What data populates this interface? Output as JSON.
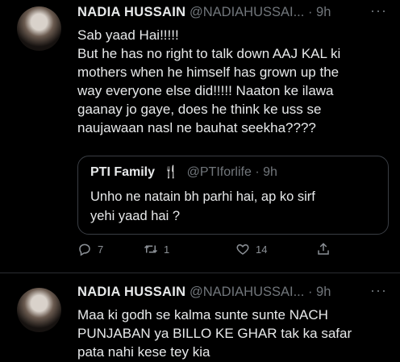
{
  "tweets": [
    {
      "name": "NADIA HUSSAIN",
      "handle": "@NADIAHUSSAI...",
      "separator": "·",
      "time": "9h",
      "more": "···",
      "lines": [
        "Sab yaad Hai!!!!!",
        "But he has no right to talk down AAJ KAL ki",
        "mothers when he himself has grown up the",
        "way everyone else did!!!!! Naaton ke ilawa",
        "gaanay jo gaye, does he think ke uss se",
        "naujawaan nasl ne bauhat seekha????"
      ],
      "quote": {
        "name": "PTI Family",
        "badge": "🍴",
        "handle": "@PTIforlife",
        "separator": "·",
        "time": "9h",
        "lines": [
          "Unho ne natain bh parhi hai, ap ko sirf",
          "yehi yaad hai ?"
        ]
      },
      "actions": {
        "replies": "7",
        "retweets": "1",
        "likes": "14"
      },
      "icons": [
        "reply-icon",
        "retweet-icon",
        "like-icon",
        "share-icon"
      ]
    },
    {
      "name": "NADIA HUSSAIN",
      "handle": "@NADIAHUSSAI...",
      "separator": "·",
      "time": "9h",
      "more": "···",
      "lines": [
        "Maa ki godh se kalma sunte sunte NACH",
        "PUNJABAN ya BILLO KE GHAR tak ka safar",
        "pata nahi kese tey kia"
      ]
    }
  ]
}
